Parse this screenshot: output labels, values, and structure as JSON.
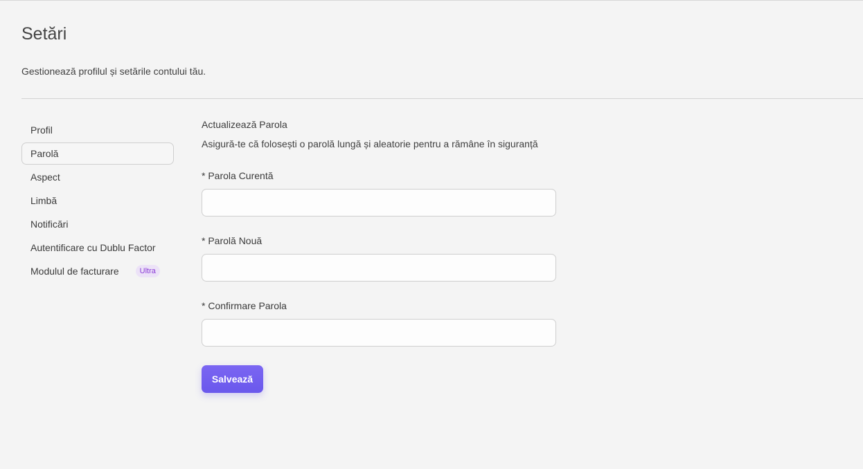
{
  "header": {
    "title": "Setări",
    "subtitle": "Gestionează profilul și setările contului tău."
  },
  "sidebar": {
    "items": [
      {
        "label": "Profil"
      },
      {
        "label": "Parolă",
        "active": true
      },
      {
        "label": "Aspect"
      },
      {
        "label": "Limbă"
      },
      {
        "label": "Notificări"
      },
      {
        "label": "Autentificare cu Dublu Factor"
      },
      {
        "label": "Modulul de facturare",
        "badge": "Ultra"
      }
    ]
  },
  "main": {
    "section_title": "Actualizează Parola",
    "section_description": "Asigură-te că folosești o parolă lungă și aleatorie pentru a rămâne în siguranță",
    "fields": [
      {
        "label": "* Parola Curentă",
        "value": "",
        "placeholder": ""
      },
      {
        "label": "* Parolă Nouă",
        "value": "",
        "placeholder": ""
      },
      {
        "label": "* Confirmare Parola",
        "value": "",
        "placeholder": ""
      }
    ],
    "save_label": "Salvează"
  },
  "colors": {
    "accent": "#6f5cef",
    "badge_text": "#8a3ad6",
    "badge_bg": "#ece2f7",
    "background": "#f4f4f4"
  }
}
